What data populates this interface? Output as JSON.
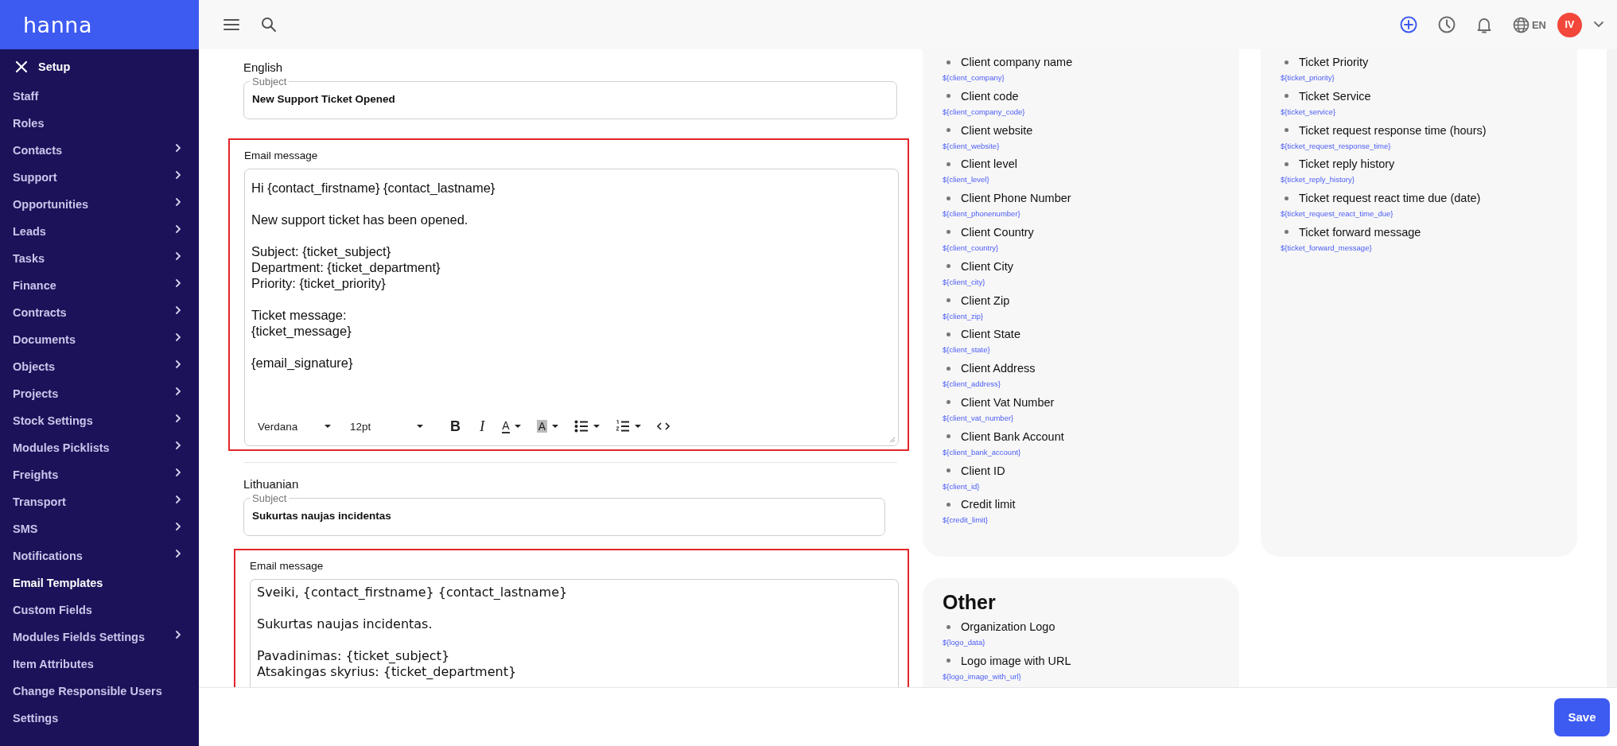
{
  "app": {
    "logo": "hanna"
  },
  "sidebar": {
    "header": "Setup",
    "items": [
      {
        "label": "Staff",
        "has_submenu": false,
        "selected": false
      },
      {
        "label": "Roles",
        "has_submenu": false,
        "selected": false
      },
      {
        "label": "Contacts",
        "has_submenu": true,
        "selected": false
      },
      {
        "label": "Support",
        "has_submenu": true,
        "selected": false
      },
      {
        "label": "Opportunities",
        "has_submenu": true,
        "selected": false
      },
      {
        "label": "Leads",
        "has_submenu": true,
        "selected": false
      },
      {
        "label": "Tasks",
        "has_submenu": true,
        "selected": false
      },
      {
        "label": "Finance",
        "has_submenu": true,
        "selected": false
      },
      {
        "label": "Contracts",
        "has_submenu": true,
        "selected": false
      },
      {
        "label": "Documents",
        "has_submenu": true,
        "selected": false
      },
      {
        "label": "Objects",
        "has_submenu": true,
        "selected": false
      },
      {
        "label": "Projects",
        "has_submenu": true,
        "selected": false
      },
      {
        "label": "Stock Settings",
        "has_submenu": true,
        "selected": false
      },
      {
        "label": "Modules Picklists",
        "has_submenu": true,
        "selected": false
      },
      {
        "label": "Freights",
        "has_submenu": true,
        "selected": false
      },
      {
        "label": "Transport",
        "has_submenu": true,
        "selected": false
      },
      {
        "label": "SMS",
        "has_submenu": true,
        "selected": false
      },
      {
        "label": "Notifications",
        "has_submenu": true,
        "selected": false
      },
      {
        "label": "Email Templates",
        "has_submenu": false,
        "selected": true
      },
      {
        "label": "Custom Fields",
        "has_submenu": false,
        "selected": false
      },
      {
        "label": "Modules Fields Settings",
        "has_submenu": true,
        "selected": false
      },
      {
        "label": "Item Attributes",
        "has_submenu": false,
        "selected": false
      },
      {
        "label": "Change Responsible Users",
        "has_submenu": false,
        "selected": false
      },
      {
        "label": "Settings",
        "has_submenu": false,
        "selected": false
      }
    ]
  },
  "topbar": {
    "language": "EN",
    "avatar": "IV"
  },
  "languages": [
    {
      "name": "English",
      "subject_label": "Subject",
      "subject": "New Support Ticket Opened",
      "message_label": "Email message",
      "highlighted": true,
      "paragraphs": [
        [
          "Hi {contact_firstname} {contact_lastname}"
        ],
        [
          "New support ticket has been opened."
        ],
        [
          "Subject: {ticket_subject}",
          "Department: {ticket_department}",
          "Priority: {ticket_priority}"
        ],
        [
          "Ticket message:",
          "{ticket_message}"
        ],
        [
          "{email_signature}"
        ]
      ],
      "toolbar": [
        {
          "kind": "select",
          "label": "Verdana"
        },
        {
          "kind": "select",
          "label": "12pt"
        },
        {
          "kind": "bold",
          "label": "B"
        },
        {
          "kind": "italic",
          "label": "I"
        },
        {
          "kind": "text-color",
          "label": "A"
        },
        {
          "kind": "highlight",
          "label": "A"
        },
        {
          "kind": "bullets"
        },
        {
          "kind": "numbers"
        },
        {
          "kind": "code"
        }
      ]
    },
    {
      "name": "Lithuanian",
      "subject_label": "Subject",
      "subject": "Sukurtas naujas incidentas",
      "message_label": "Email message",
      "highlighted": true,
      "paragraphs": [
        [
          "Sveiki, {contact_firstname} {contact_lastname}"
        ],
        [
          "Sukurtas naujas incidentas."
        ],
        [
          "Pavadinimas: {ticket_subject}",
          "Atsakingas skyrius: {ticket_department}"
        ]
      ]
    }
  ],
  "placeholder_groups": [
    {
      "items": [
        {
          "label": "Client company name",
          "variable": "${client_company}"
        },
        {
          "label": "Client code",
          "variable": "${client_company_code}"
        },
        {
          "label": "Client website",
          "variable": "${client_website}"
        },
        {
          "label": "Client level",
          "variable": "${client_level}"
        },
        {
          "label": "Client Phone Number",
          "variable": "${client_phonenumber}"
        },
        {
          "label": "Client Country",
          "variable": "${client_country}"
        },
        {
          "label": "Client City",
          "variable": "${client_city}"
        },
        {
          "label": "Client Zip",
          "variable": "${client_zip}"
        },
        {
          "label": "Client State",
          "variable": "${client_state}"
        },
        {
          "label": "Client Address",
          "variable": "${client_address}"
        },
        {
          "label": "Client Vat Number",
          "variable": "${client_vat_number}"
        },
        {
          "label": "Client Bank Account",
          "variable": "${client_bank_account}"
        },
        {
          "label": "Client ID",
          "variable": "${client_id}"
        },
        {
          "label": "Credit limit",
          "variable": "${credit_limit}"
        }
      ]
    },
    {
      "items": [
        {
          "label": "Ticket Priority",
          "variable": "${ticket_priority}"
        },
        {
          "label": "Ticket Service",
          "variable": "${ticket_service}"
        },
        {
          "label": "Ticket request response time (hours)",
          "variable": "${ticket_request_response_time}"
        },
        {
          "label": "Ticket reply history",
          "variable": "${ticket_reply_history}"
        },
        {
          "label": "Ticket request react time due (date)",
          "variable": "${ticket_request_react_time_due}"
        },
        {
          "label": "Ticket forward message",
          "variable": "${ticket_forward_message}"
        }
      ]
    },
    {
      "title": "Other",
      "items": [
        {
          "label": "Organization Logo",
          "variable": "${logo_data}"
        },
        {
          "label": "Logo image with URL",
          "variable": "${logo_image_with_url}"
        }
      ]
    }
  ],
  "footer": {
    "save": "Save"
  }
}
